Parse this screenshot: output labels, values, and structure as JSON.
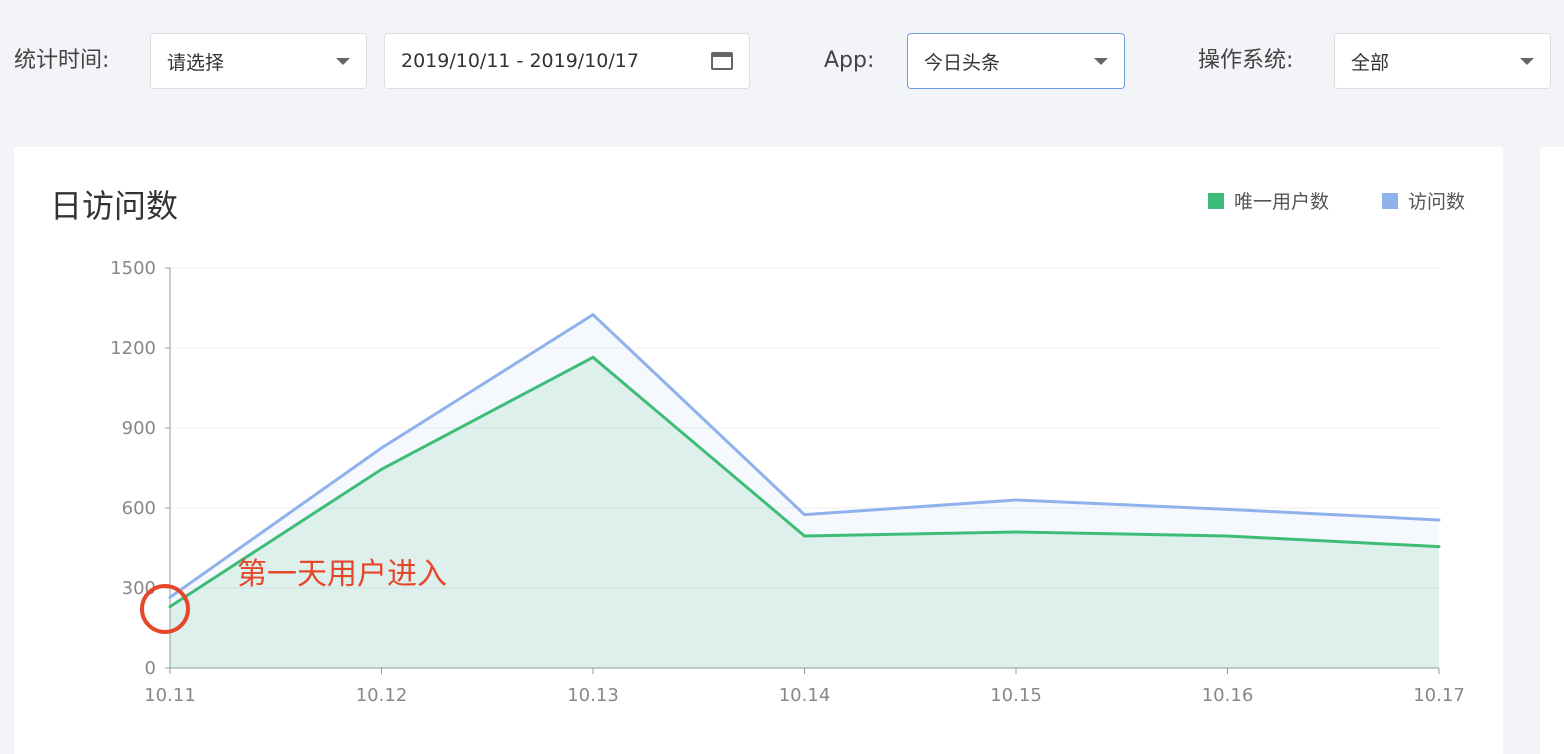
{
  "filters": {
    "time_label": "统计时间:",
    "time_select": "请选择",
    "date_range": "2019/10/11 - 2019/10/17",
    "app_label": "App:",
    "app_value": "今日头条",
    "os_label": "操作系统:",
    "os_value": "全部"
  },
  "colors": {
    "unique_users": "#3dbd77",
    "visits": "#8fb2ec",
    "annotation": "#e6472a"
  },
  "chart": {
    "title": "日访问数",
    "annotation": "第一天用户进入"
  },
  "chart_data": {
    "type": "area",
    "title": "日访问数",
    "categories": [
      "10.11",
      "10.12",
      "10.13",
      "10.14",
      "10.15",
      "10.16",
      "10.17"
    ],
    "y_ticks": [
      "0",
      "300",
      "600",
      "900",
      "1200",
      "1500"
    ],
    "ylim": [
      0,
      1500
    ],
    "grid": true,
    "legend_position": "top-right",
    "series": [
      {
        "name": "唯一用户数",
        "values": [
          230,
          745,
          1165,
          495,
          510,
          495,
          455
        ]
      },
      {
        "name": "访问数",
        "values": [
          265,
          825,
          1325,
          575,
          630,
          595,
          555
        ]
      }
    ]
  }
}
